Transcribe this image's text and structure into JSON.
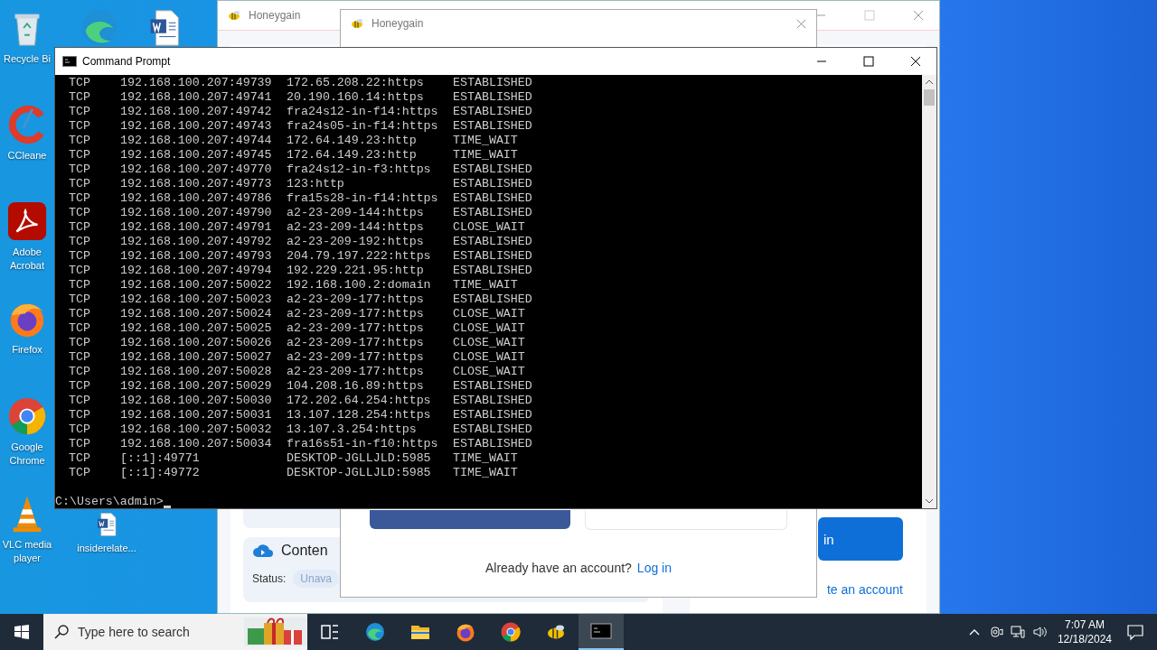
{
  "desktop_icons": [
    {
      "kind": "recycle",
      "label": "Recycle Bi"
    },
    {
      "kind": "edge"
    },
    {
      "kind": "word"
    },
    {
      "kind": "ccleaner",
      "label": "CCleane"
    },
    {
      "kind": "acrobat",
      "label": "Adobe Acrobat"
    },
    {
      "kind": "firefox",
      "label": "Firefox"
    },
    {
      "kind": "chrome",
      "label": "Google Chrome"
    },
    {
      "kind": "vlc",
      "label": "VLC media player"
    },
    {
      "kind": "word",
      "label": "insiderelate..."
    }
  ],
  "honeygain_window": {
    "title": "Honeygain",
    "card_title": "Conten",
    "status_label": "Status:",
    "status_value": "Unava",
    "button_text": "in",
    "link": "te an account"
  },
  "honeygain_dialog": {
    "title": "Honeygain",
    "question": "Already have an account?",
    "login_link": "Log in"
  },
  "command_prompt": {
    "title": "Command Prompt",
    "rows": [
      {
        "proto": "TCP",
        "local": "192.168.100.207:49739",
        "foreign": "172.65.208.22:https",
        "state": "ESTABLISHED"
      },
      {
        "proto": "TCP",
        "local": "192.168.100.207:49741",
        "foreign": "20.190.160.14:https",
        "state": "ESTABLISHED"
      },
      {
        "proto": "TCP",
        "local": "192.168.100.207:49742",
        "foreign": "fra24s12-in-f14:https",
        "state": "ESTABLISHED"
      },
      {
        "proto": "TCP",
        "local": "192.168.100.207:49743",
        "foreign": "fra24s05-in-f14:https",
        "state": "ESTABLISHED"
      },
      {
        "proto": "TCP",
        "local": "192.168.100.207:49744",
        "foreign": "172.64.149.23:http",
        "state": "TIME_WAIT"
      },
      {
        "proto": "TCP",
        "local": "192.168.100.207:49745",
        "foreign": "172.64.149.23:http",
        "state": "TIME_WAIT"
      },
      {
        "proto": "TCP",
        "local": "192.168.100.207:49770",
        "foreign": "fra24s12-in-f3:https",
        "state": "ESTABLISHED"
      },
      {
        "proto": "TCP",
        "local": "192.168.100.207:49773",
        "foreign": "123:http",
        "state": "ESTABLISHED"
      },
      {
        "proto": "TCP",
        "local": "192.168.100.207:49786",
        "foreign": "fra15s28-in-f14:https",
        "state": "ESTABLISHED"
      },
      {
        "proto": "TCP",
        "local": "192.168.100.207:49790",
        "foreign": "a2-23-209-144:https",
        "state": "ESTABLISHED"
      },
      {
        "proto": "TCP",
        "local": "192.168.100.207:49791",
        "foreign": "a2-23-209-144:https",
        "state": "CLOSE_WAIT"
      },
      {
        "proto": "TCP",
        "local": "192.168.100.207:49792",
        "foreign": "a2-23-209-192:https",
        "state": "ESTABLISHED"
      },
      {
        "proto": "TCP",
        "local": "192.168.100.207:49793",
        "foreign": "204.79.197.222:https",
        "state": "ESTABLISHED"
      },
      {
        "proto": "TCP",
        "local": "192.168.100.207:49794",
        "foreign": "192.229.221.95:http",
        "state": "ESTABLISHED"
      },
      {
        "proto": "TCP",
        "local": "192.168.100.207:50022",
        "foreign": "192.168.100.2:domain",
        "state": "TIME_WAIT"
      },
      {
        "proto": "TCP",
        "local": "192.168.100.207:50023",
        "foreign": "a2-23-209-177:https",
        "state": "ESTABLISHED"
      },
      {
        "proto": "TCP",
        "local": "192.168.100.207:50024",
        "foreign": "a2-23-209-177:https",
        "state": "CLOSE_WAIT"
      },
      {
        "proto": "TCP",
        "local": "192.168.100.207:50025",
        "foreign": "a2-23-209-177:https",
        "state": "CLOSE_WAIT"
      },
      {
        "proto": "TCP",
        "local": "192.168.100.207:50026",
        "foreign": "a2-23-209-177:https",
        "state": "CLOSE_WAIT"
      },
      {
        "proto": "TCP",
        "local": "192.168.100.207:50027",
        "foreign": "a2-23-209-177:https",
        "state": "CLOSE_WAIT"
      },
      {
        "proto": "TCP",
        "local": "192.168.100.207:50028",
        "foreign": "a2-23-209-177:https",
        "state": "CLOSE_WAIT"
      },
      {
        "proto": "TCP",
        "local": "192.168.100.207:50029",
        "foreign": "104.208.16.89:https",
        "state": "ESTABLISHED"
      },
      {
        "proto": "TCP",
        "local": "192.168.100.207:50030",
        "foreign": "172.202.64.254:https",
        "state": "ESTABLISHED"
      },
      {
        "proto": "TCP",
        "local": "192.168.100.207:50031",
        "foreign": "13.107.128.254:https",
        "state": "ESTABLISHED"
      },
      {
        "proto": "TCP",
        "local": "192.168.100.207:50032",
        "foreign": "13.107.3.254:https",
        "state": "ESTABLISHED"
      },
      {
        "proto": "TCP",
        "local": "192.168.100.207:50034",
        "foreign": "fra16s51-in-f10:https",
        "state": "ESTABLISHED"
      },
      {
        "proto": "TCP",
        "local": "[::1]:49771",
        "foreign": "DESKTOP-JGLLJLD:5985",
        "state": "TIME_WAIT"
      },
      {
        "proto": "TCP",
        "local": "[::1]:49772",
        "foreign": "DESKTOP-JGLLJLD:5985",
        "state": "TIME_WAIT"
      }
    ],
    "prompt": "C:\\Users\\admin>"
  },
  "taskbar": {
    "search_placeholder": "Type here to search",
    "apps": [
      {
        "kind": "taskview",
        "selected": false
      },
      {
        "kind": "edge",
        "selected": false
      },
      {
        "kind": "explorer",
        "selected": false
      },
      {
        "kind": "firefox",
        "selected": false
      },
      {
        "kind": "chrome",
        "selected": false
      },
      {
        "kind": "honeygain",
        "selected": false
      },
      {
        "kind": "cmd",
        "selected": true
      }
    ],
    "time": "7:07 AM",
    "date": "12/18/2024"
  }
}
